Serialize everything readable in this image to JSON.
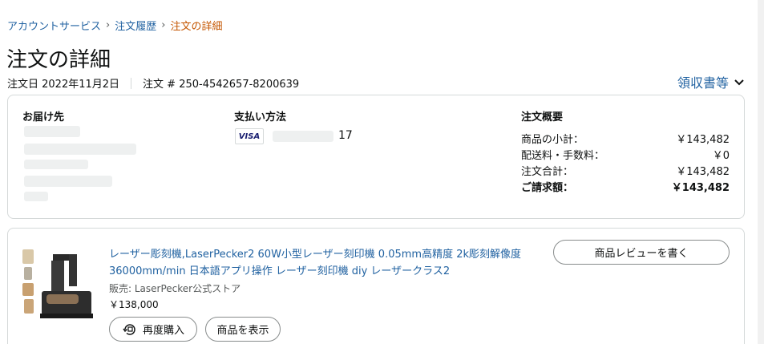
{
  "breadcrumb": {
    "account": "アカウントサービス",
    "sep": "›",
    "history": "注文履歴",
    "current": "注文の詳細"
  },
  "page": {
    "title": "注文の詳細",
    "order_date": "注文日 2022年11月2日",
    "order_number": "注文 # 250-4542657-8200639",
    "receipt_label": "領収書等"
  },
  "shipping": {
    "title": "お届け先"
  },
  "payment": {
    "title": "支払い方法",
    "card_brand": "VISA",
    "card_last_digits": "17"
  },
  "summary": {
    "title": "注文概要",
    "rows": [
      {
        "label": "商品の小計：",
        "value": "￥143,482"
      },
      {
        "label": "配送料・手数料：",
        "value": "￥0"
      },
      {
        "label": "注文合計：",
        "value": "￥143,482"
      },
      {
        "label": "ご請求額：",
        "value": "￥143,482"
      }
    ]
  },
  "item": {
    "title": "レーザー彫刻機,LaserPecker2 60W小型レーザー刻印機 0.05mm高精度 2k彫刻解像度 36000mm/min 日本語アプリ操作 レーザー刻印機 diy レーザークラス2",
    "seller": "販売: LaserPecker公式ストア",
    "price": "￥138,000",
    "rebuy_label": "再度購入",
    "view_label": "商品を表示",
    "review_label": "商品レビューを書く"
  },
  "colors": {
    "link": "#2162a1",
    "breadcrumb_current": "#c45500",
    "border": "#d5d9d9"
  }
}
